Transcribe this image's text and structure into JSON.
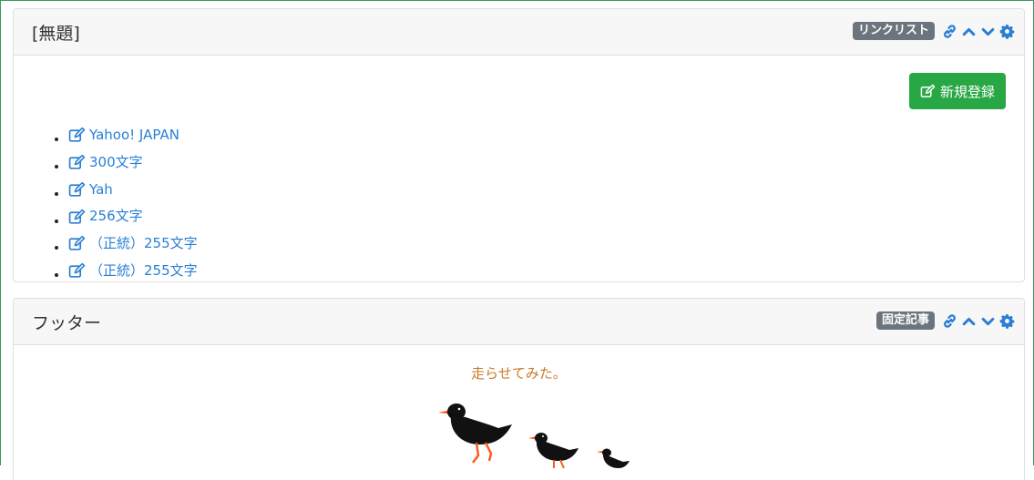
{
  "frame_color": "#3c9a5a",
  "link_card": {
    "title": "[無題]",
    "badge": "リンクリスト",
    "icons": [
      "link-icon",
      "chevron-up-icon",
      "chevron-down-icon",
      "gear-icon"
    ],
    "new_button_label": "新規登録",
    "links": [
      {
        "label": "Yahoo! JAPAN"
      },
      {
        "label": "300文字"
      },
      {
        "label": "Yah"
      },
      {
        "label": "256文字"
      },
      {
        "label": "（正統）255文字"
      },
      {
        "label": "（正統）255文字"
      }
    ]
  },
  "footer_card": {
    "title": "フッター",
    "badge": "固定記事",
    "icons": [
      "link-icon",
      "chevron-up-icon",
      "chevron-down-icon",
      "gear-icon"
    ],
    "text": "走らせてみた。",
    "image": "three-running-birds-illustration"
  },
  "colors": {
    "badge": "#6c757d",
    "link": "#2a7fd4",
    "button": "#28a745",
    "footer_text": "#c97a2a"
  }
}
